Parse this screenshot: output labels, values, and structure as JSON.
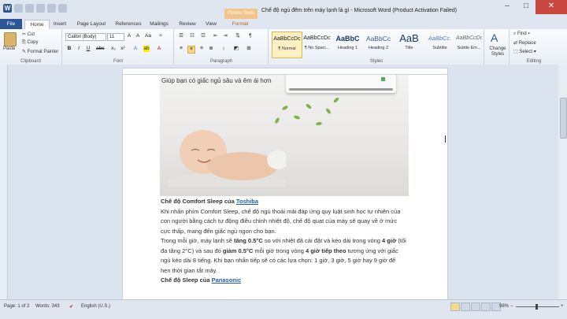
{
  "window": {
    "title": "Chế độ ngủ đêm trên máy lạnh là gì  -  Microsoft Word (Product Activation Failed)",
    "context_tab": "Picture Tools",
    "controls": [
      "–",
      "□",
      "✕"
    ]
  },
  "tabs": [
    "File",
    "Home",
    "Insert",
    "Page Layout",
    "References",
    "Mailings",
    "Review",
    "View",
    "Format"
  ],
  "ribbon": {
    "clipboard": {
      "paste": "Paste",
      "cut": "Cut",
      "copy": "Copy",
      "format_painter": "Format Painter",
      "label": "Clipboard"
    },
    "font": {
      "name": "Calibri (Body)",
      "size": "11",
      "label": "Font",
      "bold": "B",
      "italic": "I",
      "underline": "U"
    },
    "paragraph": {
      "label": "Paragraph"
    },
    "styles": {
      "label": "Styles",
      "items": [
        {
          "preview": "AaBbCcDc",
          "name": "¶ Normal"
        },
        {
          "preview": "AaBbCcDc",
          "name": "¶ No Spaci..."
        },
        {
          "preview": "AaBbC",
          "name": "Heading 1"
        },
        {
          "preview": "AaBbCc",
          "name": "Heading 2"
        },
        {
          "preview": "AaB",
          "name": "Title"
        },
        {
          "preview": "AaBbCc.",
          "name": "Subtitle"
        },
        {
          "preview": "AaBbCcDc",
          "name": "Subtle Em..."
        }
      ],
      "change_styles": "Change Styles"
    },
    "editing": {
      "find": "Find",
      "replace": "Replace",
      "select": "Select",
      "label": "Editing"
    }
  },
  "document": {
    "image_caption": "Giúp bạn có giấc ngủ sâu và êm ái hơn",
    "heading1_prefix": "Chế độ Comfort Sleep của ",
    "heading1_link": "Toshiba",
    "para1": "Khi nhấn phím Comfort Sleep, chế độ ngủ thoải mái đáp ứng quy luật sinh học tự nhiên của con người bằng cách tự động điều chỉnh nhiệt độ, chế độ quạt của máy sẽ quay về ở mức cực thấp, mang đến giấc ngủ ngon cho bạn.",
    "para2_a": "Trong mỗi giờ, máy lạnh sẽ ",
    "para2_b": "tăng 0.5°C",
    "para2_c": " so với nhiệt đã cài đặt và kéo dài trong vòng ",
    "para2_d": "4 giờ",
    "para2_e": " (tối đa tăng 2°C) và sau đó ",
    "para2_f": "giảm 0.5°C",
    "para2_g": " mỗi giờ trong vòng ",
    "para2_h": "4 giờ tiếp theo",
    "para2_i": " tương ứng với giấc ngủ kéo dài 8 tiếng. Khi bạn nhấn tiếp sẽ có các lựa chọn: 1 giờ, 3 giờ, 5 giờ hay 9 giờ để hẹn thời gian tắt máy.",
    "heading2_prefix": "Chế độ Sleep của ",
    "heading2_link": "Panasonic"
  },
  "status": {
    "page": "Page: 1 of 2",
    "words": "Words: 343",
    "language": "English (U.S.)",
    "zoom": "98%",
    "zoom_value": 98
  },
  "colors": {
    "file_tab": "#2b5797",
    "link": "#1f5fa5",
    "context_tab": "#f3c38a",
    "close": "#c9473e"
  }
}
